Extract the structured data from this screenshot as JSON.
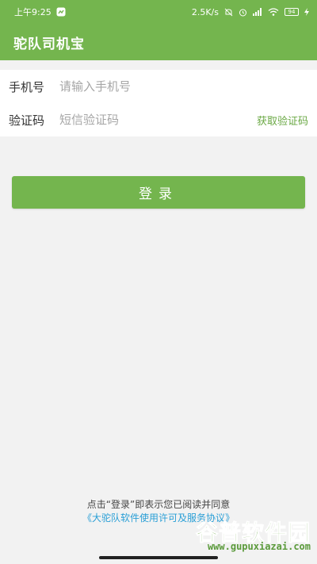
{
  "status_bar": {
    "time": "上午9:25",
    "net_speed": "2.5K/s",
    "battery": "94"
  },
  "app_bar": {
    "title": "驼队司机宝"
  },
  "form": {
    "phone": {
      "label": "手机号",
      "placeholder": "请输入手机号",
      "value": ""
    },
    "code": {
      "label": "验证码",
      "placeholder": "短信验证码",
      "value": "",
      "get_code_label": "获取验证码"
    }
  },
  "login": {
    "label": "登录"
  },
  "agreement": {
    "notice": "点击“登录”即表示您已阅读并同意",
    "link": "《大驼队软件使用许可及服务协议》"
  },
  "watermark": {
    "title": "谷普软件园",
    "url": "www.gupuxiazai.com"
  },
  "colors": {
    "primary": "#74b54e",
    "link": "#2a9fd6",
    "background": "#f2f2f2"
  }
}
